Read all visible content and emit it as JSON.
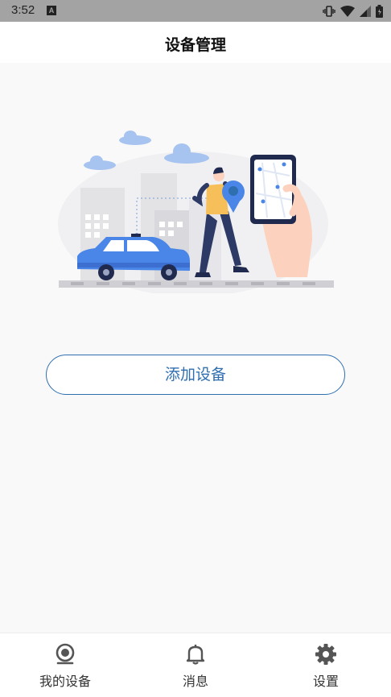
{
  "status_bar": {
    "time": "3:52",
    "notification_icon": "A"
  },
  "header": {
    "title": "设备管理"
  },
  "main": {
    "add_button_label": "添加设备",
    "illustration": "car-tracking-illustration"
  },
  "tabs": [
    {
      "label": "我的设备",
      "icon": "camera-icon"
    },
    {
      "label": "消息",
      "icon": "bell-icon"
    },
    {
      "label": "设置",
      "icon": "gear-icon"
    }
  ],
  "colors": {
    "accent": "#2f6fb0",
    "illustration_blue": "#4a86e8",
    "status_bar": "#a3a3a3"
  }
}
